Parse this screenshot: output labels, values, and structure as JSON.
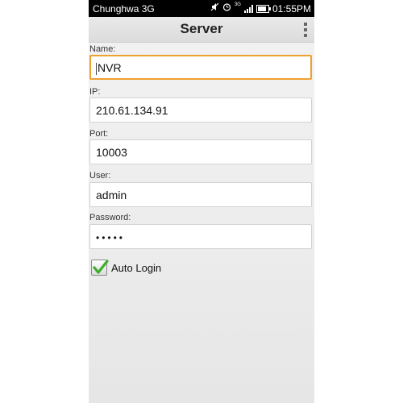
{
  "status_bar": {
    "carrier": "Chunghwa 3G",
    "network_type": "3G",
    "time": "01:55PM",
    "icons": [
      "mute-icon",
      "alarm-icon",
      "signal-icon",
      "battery-icon"
    ]
  },
  "header": {
    "title": "Server"
  },
  "form": {
    "name_label": "Name:",
    "name_value": "NVR",
    "ip_label": "IP:",
    "ip_value": "210.61.134.91",
    "port_label": "Port:",
    "port_value": "10003",
    "user_label": "User:",
    "user_value": "admin",
    "password_label": "Password:",
    "password_value": "•••••",
    "auto_login_label": "Auto Login"
  },
  "colors": {
    "focus_border": "#f0a030",
    "check_green": "#3fae2a",
    "status_bar_bg": "#000000"
  }
}
